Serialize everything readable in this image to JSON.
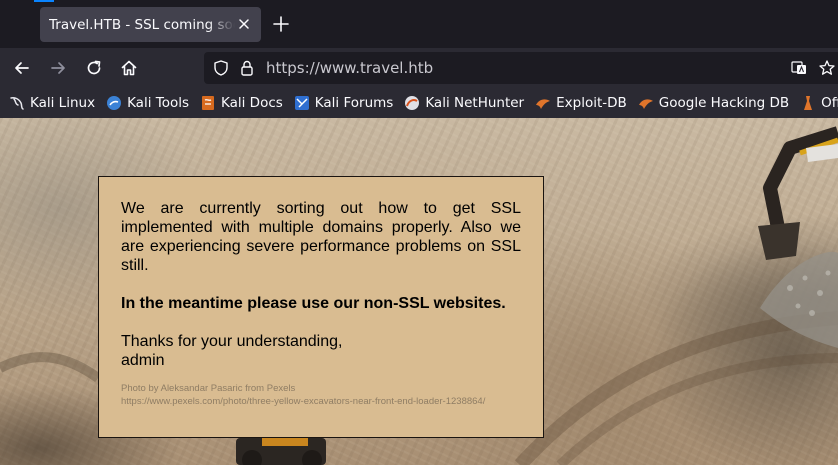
{
  "browser": {
    "tab": {
      "title": "Travel.HTB - SSL coming soon"
    },
    "url": "https://www.travel.htb",
    "icons": {
      "close": "close-icon",
      "new_tab": "plus-icon",
      "back": "arrow-left-icon",
      "forward": "arrow-right-icon",
      "reload": "reload-icon",
      "home": "home-icon",
      "shield": "shield-icon",
      "lock": "lock-icon",
      "translate": "translate-icon",
      "star": "star-icon"
    },
    "bookmarks": [
      {
        "label": "Kali Linux",
        "icon": "kali-dragon-icon"
      },
      {
        "label": "Kali Tools",
        "icon": "kali-tools-icon"
      },
      {
        "label": "Kali Docs",
        "icon": "kali-docs-icon"
      },
      {
        "label": "Kali Forums",
        "icon": "kali-forums-icon"
      },
      {
        "label": "Kali NetHunter",
        "icon": "nethunter-icon"
      },
      {
        "label": "Exploit-DB",
        "icon": "exploit-db-icon"
      },
      {
        "label": "Google Hacking DB",
        "icon": "ghdb-icon"
      },
      {
        "label": "OffSec",
        "icon": "offsec-icon"
      }
    ]
  },
  "page": {
    "message": "We are currently sorting out how to get SSL implemented with multiple domains properly. Also we are experiencing severe performance problems on SSL still.",
    "emphasis": "In the meantime please use our non-SSL websites.",
    "thanks": "Thanks for your understanding,",
    "signature": "admin",
    "credit_line1": "Photo by Aleksandar Pasaric from Pexels",
    "credit_line2": "https://www.pexels.com/photo/three-yellow-excavators-near-front-end-loader-1238864/"
  },
  "colors": {
    "tab_bar": "#1c1b22",
    "toolbar": "#2b2a33",
    "active_tab": "#42414d",
    "notice_bg": "#d9bc91"
  }
}
